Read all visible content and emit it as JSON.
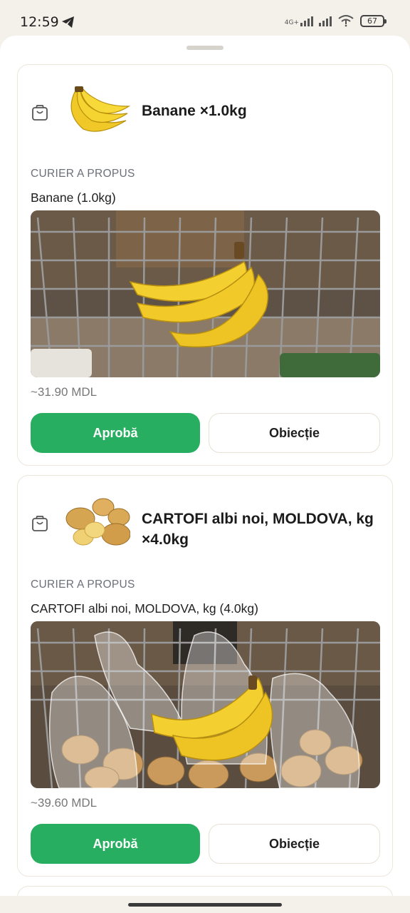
{
  "status_bar": {
    "time": "12:59",
    "network": "4G+",
    "battery": "67"
  },
  "items": [
    {
      "title": "Banane ×1.0kg",
      "section_label": "CURIER A PROPUS",
      "proposed_name": "Banane (1.0kg)",
      "price": "~31.90 MDL",
      "approve_label": "Aprobă",
      "object_label": "Obiecție"
    },
    {
      "title": "CARTOFI albi noi, MOLDOVA, kg ×4.0kg",
      "section_label": "CURIER A PROPUS",
      "proposed_name": "CARTOFI albi noi, MOLDOVA, kg (4.0kg)",
      "price": "~39.60 MDL",
      "approve_label": "Aprobă",
      "object_label": "Obiecție"
    }
  ],
  "colors": {
    "accent_green": "#27ae60",
    "background": "#f4f1ea"
  }
}
